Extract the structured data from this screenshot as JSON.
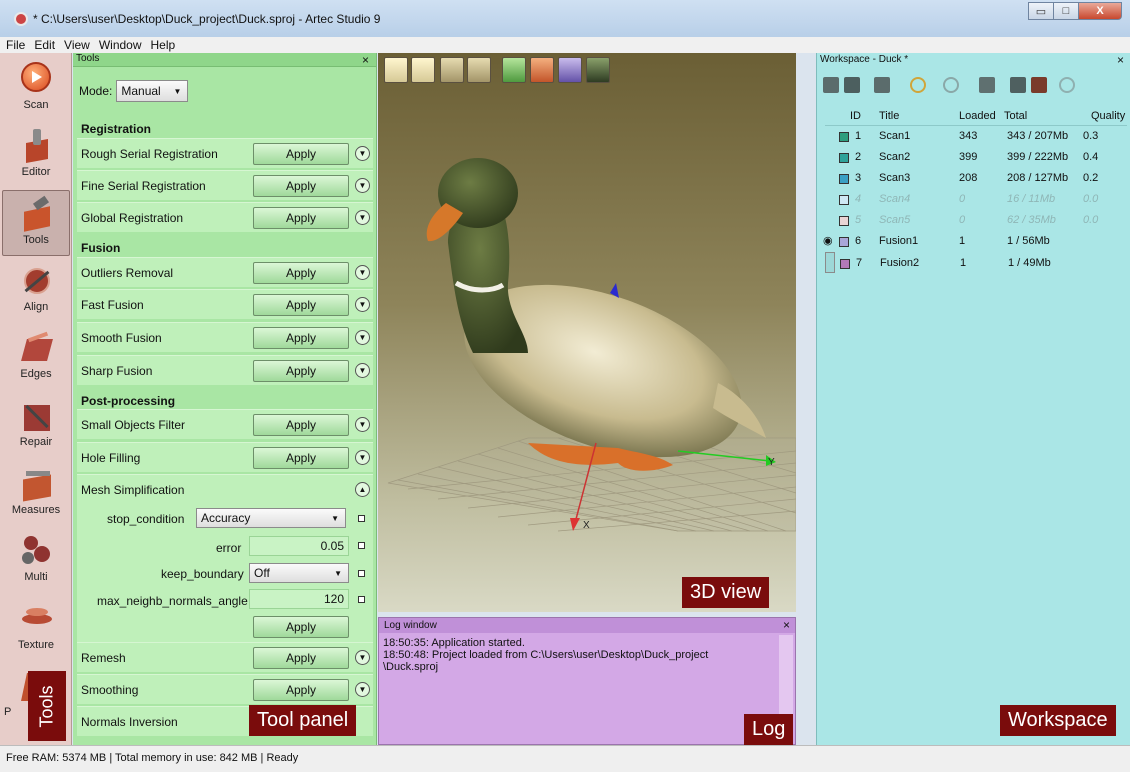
{
  "window": {
    "title": "* C:\\Users\\user\\Desktop\\Duck_project\\Duck.sproj - Artec Studio 9",
    "minimize": "▭",
    "maximize": "□",
    "close": "X"
  },
  "menu": [
    "File",
    "Edit",
    "View",
    "Window",
    "Help"
  ],
  "leftbar": {
    "items": [
      {
        "label": "Scan",
        "icon": "scan-icon",
        "color": "#e3592a"
      },
      {
        "label": "Editor",
        "icon": "editor-icon",
        "color": "#b5482a"
      },
      {
        "label": "Tools",
        "icon": "tools-icon",
        "color": "#c9542c"
      },
      {
        "label": "Align",
        "icon": "align-icon",
        "color": "#a23d2e"
      },
      {
        "label": "Edges",
        "icon": "edges-icon",
        "color": "#b2473c"
      },
      {
        "label": "Repair",
        "icon": "repair-icon",
        "color": "#9b3a34"
      },
      {
        "label": "Measures",
        "icon": "measures-icon",
        "color": "#c25630"
      },
      {
        "label": "Multi",
        "icon": "multi-icon",
        "color": "#8f3330"
      },
      {
        "label": "Texture",
        "icon": "texture-icon",
        "color": "#b84b34"
      },
      {
        "label": "P",
        "icon": "publish-icon",
        "color": "#c0502d"
      }
    ],
    "tag": "Tools"
  },
  "tools": {
    "header": "Tools",
    "close": "×",
    "mode_label": "Mode:",
    "mode_value": "Manual",
    "sections": {
      "registration": "Registration",
      "fusion": "Fusion",
      "post": "Post-processing"
    },
    "apply": "Apply",
    "rows": {
      "rough": "Rough Serial Registration",
      "fine": "Fine Serial Registration",
      "global": "Global Registration",
      "outliers": "Outliers Removal",
      "fast": "Fast Fusion",
      "smooth": "Smooth Fusion",
      "sharp": "Sharp Fusion",
      "small": "Small Objects Filter",
      "hole": "Hole Filling",
      "mesh": "Mesh Simplification",
      "remesh": "Remesh",
      "smoothing": "Smoothing",
      "normals": "Normals Inversion"
    },
    "params": {
      "stop_condition": "stop_condition",
      "stop_value": "Accuracy",
      "error": "error",
      "error_value": "0.05",
      "keep_boundary": "keep_boundary",
      "keep_value": "Off",
      "angle": "max_neighb_normals_angle",
      "angle_value": "120"
    },
    "tag": "Tool panel"
  },
  "view3d": {
    "tag": "3D view",
    "axis_x": "X",
    "axis_y": "Y"
  },
  "log": {
    "header": "Log window",
    "close": "×",
    "lines": [
      "18:50:35: Application started.",
      "18:50:48: Project loaded from C:\\Users\\user\\Desktop\\Duck_project",
      "\\Duck.sproj"
    ],
    "tag": "Log"
  },
  "workspace": {
    "header": "Workspace - Duck *",
    "close": "×",
    "columns": {
      "id": "ID",
      "title": "Title",
      "loaded": "Loaded",
      "total": "Total",
      "quality": "Quality"
    },
    "rows": [
      {
        "id": "1",
        "title": "Scan1",
        "loaded": "343",
        "total": "343 / 207Mb",
        "quality": "0.3",
        "color": "#2e9e7e",
        "state": "normal"
      },
      {
        "id": "2",
        "title": "Scan2",
        "loaded": "399",
        "total": "399 / 222Mb",
        "quality": "0.4",
        "color": "#2ea39a",
        "state": "normal"
      },
      {
        "id": "3",
        "title": "Scan3",
        "loaded": "208",
        "total": "208 / 127Mb",
        "quality": "0.2",
        "color": "#3aa0c4",
        "state": "normal"
      },
      {
        "id": "4",
        "title": "Scan4",
        "loaded": "0",
        "total": "16 / 11Mb",
        "quality": "0.0",
        "color": "#cfe9f4",
        "state": "grey"
      },
      {
        "id": "5",
        "title": "Scan5",
        "loaded": "0",
        "total": "62 / 35Mb",
        "quality": "0.0",
        "color": "#e9d4d4",
        "state": "grey"
      },
      {
        "id": "6",
        "title": "Fusion1",
        "loaded": "1",
        "total": "1 / 56Mb",
        "quality": "",
        "color": "#a9a6d8",
        "state": "visible"
      },
      {
        "id": "7",
        "title": "Fusion2",
        "loaded": "1",
        "total": "1 / 49Mb",
        "quality": "",
        "color": "#b279b8",
        "state": "selected"
      }
    ],
    "tag": "Workspace"
  },
  "status": "Free RAM: 5374 MB  |  Total memory in use: 842 MB  |     Ready"
}
